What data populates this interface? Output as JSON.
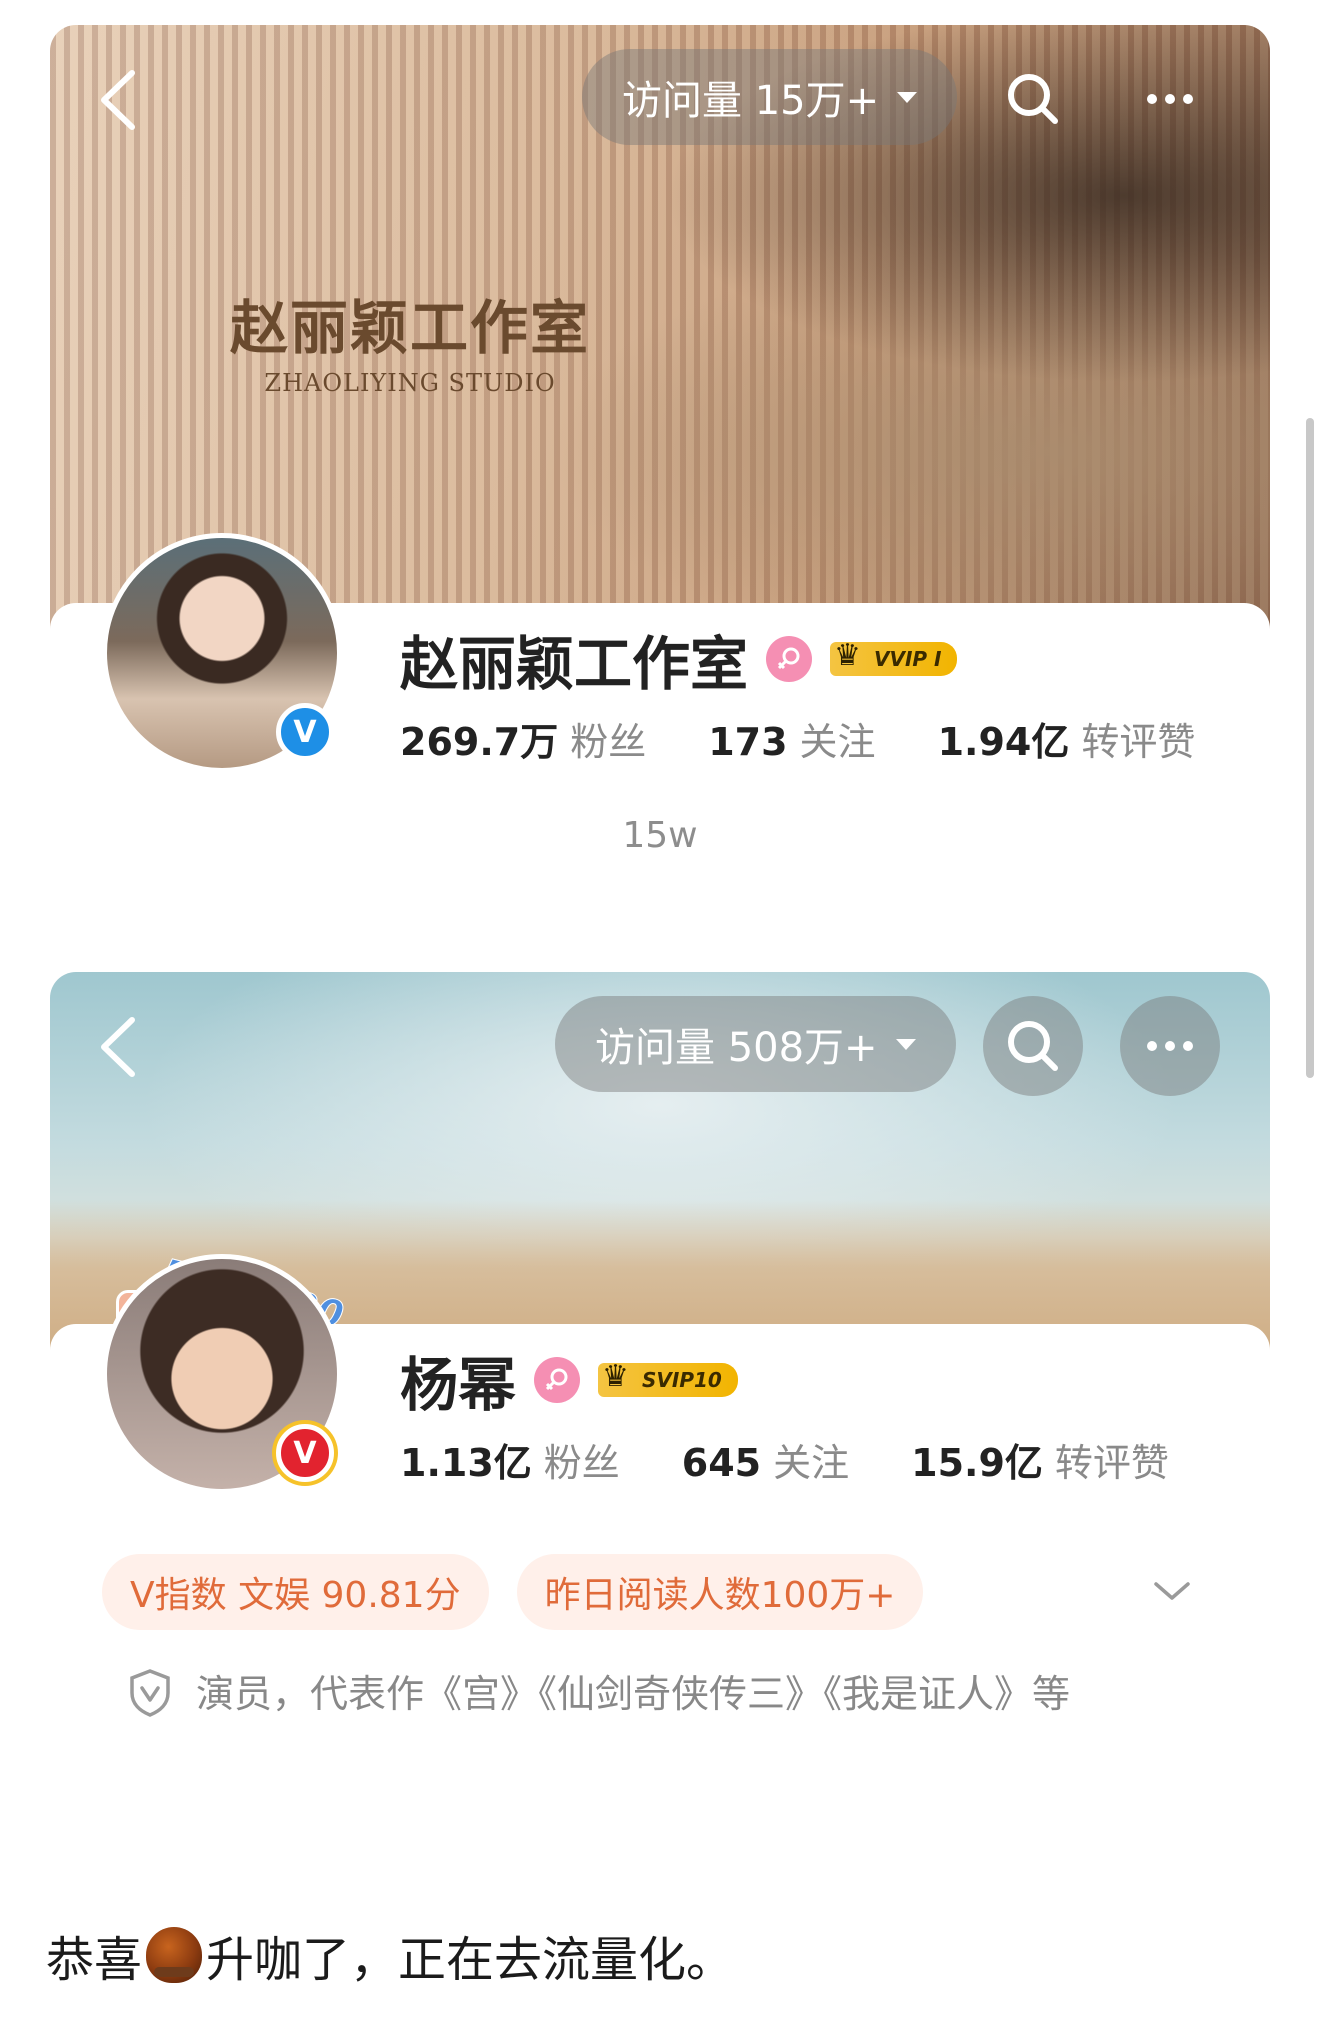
{
  "screenshot_one": {
    "banner": {
      "visits_label": "访问量 15万+",
      "studio_logo_cn": "赵丽颖工作室",
      "studio_logo_en": "ZHAOLIYING STUDIO"
    },
    "profile": {
      "name": "赵丽颖工作室",
      "vip_label": "VVIP I",
      "verified_mark": "V",
      "stats": [
        {
          "value": "269.7万",
          "label": "粉丝"
        },
        {
          "value": "173",
          "label": "关注"
        },
        {
          "value": "1.94亿",
          "label": "转评赞"
        }
      ]
    }
  },
  "separator_text": "15w",
  "screenshot_two": {
    "banner": {
      "visits_label": "访问量 508万+",
      "sticker_text": "Bye2020"
    },
    "profile": {
      "name": "杨幂",
      "vip_label": "SVIP10",
      "verified_mark": "V",
      "stats": [
        {
          "value": "1.13亿",
          "label": "粉丝"
        },
        {
          "value": "645",
          "label": "关注"
        },
        {
          "value": "15.9亿",
          "label": "转评赞"
        }
      ],
      "tags": [
        "V指数 文娱 90.81分",
        "昨日阅读人数100万+"
      ],
      "description": "演员，代表作《宫》《仙剑奇侠传三》《我是证人》等"
    }
  },
  "caption": {
    "before_icon": "恭喜",
    "after_icon": "升咖了，正在去流量化。"
  },
  "icons": [
    "back-icon",
    "caret-down-icon",
    "search-icon",
    "more-icon",
    "female-icon",
    "crown-icon",
    "verified-icon",
    "camera-icon",
    "chevron-down-icon",
    "shield-icon",
    "chestnut-icon"
  ]
}
